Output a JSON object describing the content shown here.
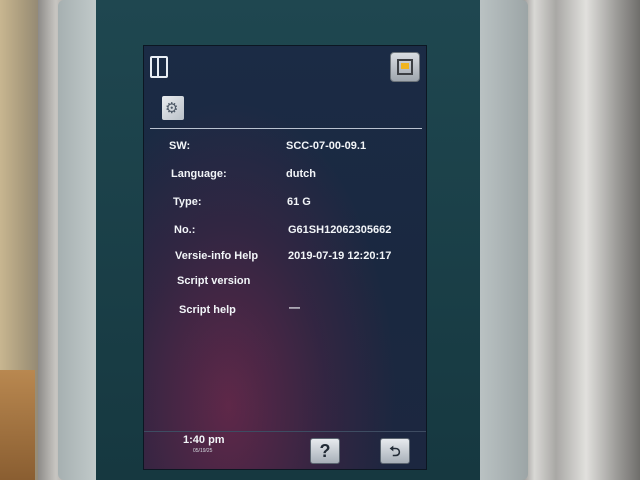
{
  "screen": {
    "info_rows": [
      {
        "label": "SW:",
        "value": "SCC-07-00-09.1"
      },
      {
        "label": "Language:",
        "value": "dutch"
      },
      {
        "label": "Type:",
        "value": "61 G"
      },
      {
        "label": "No.:",
        "value": "G61SH12062305662"
      },
      {
        "label": "Versie-info Help",
        "value": "2019-07-19 12:20:17"
      },
      {
        "label": "Script version",
        "value": ""
      },
      {
        "label": "Script help",
        "value": "—"
      }
    ],
    "footer": {
      "time": "1:40 pm",
      "date": "05/19/25",
      "help_label": "?",
      "back_label": "⮌"
    }
  }
}
